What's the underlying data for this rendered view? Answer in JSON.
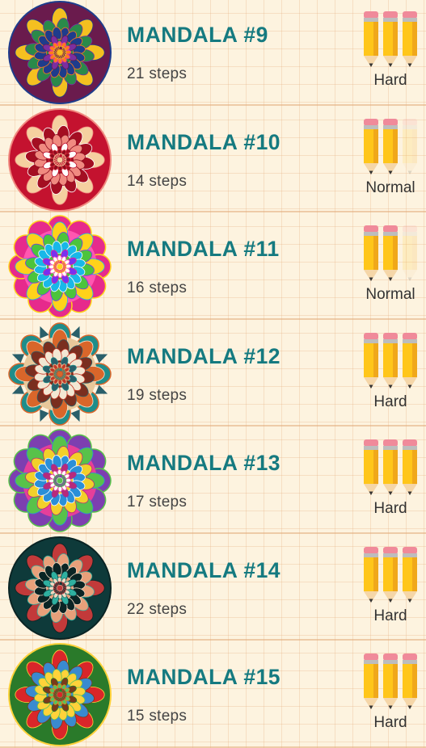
{
  "items": [
    {
      "title": "MANDALA #9",
      "steps": "21 steps",
      "difficulty": "Hard",
      "level": 3,
      "palette": [
        "#6a1b4d",
        "#e9389b",
        "#f4c020",
        "#2a8a4a",
        "#1e3c8c",
        "#7b2fa0",
        "#ff7a1a"
      ]
    },
    {
      "title": "MANDALA #10",
      "steps": "14 steps",
      "difficulty": "Normal",
      "level": 2,
      "palette": [
        "#c4122f",
        "#e1303f",
        "#f5d0a0",
        "#a40e22",
        "#f08a80",
        "#ffffff",
        "#8c0d1e"
      ]
    },
    {
      "title": "MANDALA #11",
      "steps": "16 steps",
      "difficulty": "Normal",
      "level": 2,
      "palette": [
        "#e62a8c",
        "#ff57b0",
        "#ffd21a",
        "#4cc43c",
        "#18b8e8",
        "#7a2ff0",
        "#ffffff"
      ]
    },
    {
      "title": "MANDALA #12",
      "steps": "19 steps",
      "difficulty": "Hard",
      "level": 3,
      "palette": [
        "#1f8d8a",
        "#e8c89a",
        "#d9662a",
        "#7a2e1f",
        "#f3e7d3",
        "#2a5f6a",
        "#c23a2a"
      ]
    },
    {
      "title": "MANDALA #13",
      "steps": "17 steps",
      "difficulty": "Hard",
      "level": 3,
      "palette": [
        "#7d3fb0",
        "#e63f9a",
        "#58c24a",
        "#f2d02a",
        "#2a8fd8",
        "#b82a7a",
        "#ffffff"
      ]
    },
    {
      "title": "MANDALA #14",
      "steps": "22 steps",
      "difficulty": "Hard",
      "level": 3,
      "palette": [
        "#0e3a3a",
        "#1f7c72",
        "#c23a3a",
        "#e8a07a",
        "#0a2424",
        "#2fb0a0",
        "#f0d8c0"
      ]
    },
    {
      "title": "MANDALA #15",
      "steps": "15 steps",
      "difficulty": "Hard",
      "level": 3,
      "palette": [
        "#2a7a2a",
        "#e87a1a",
        "#d9262a",
        "#3a8ad0",
        "#ffd23a",
        "#7a3a1a",
        "#5ac25a"
      ]
    }
  ]
}
